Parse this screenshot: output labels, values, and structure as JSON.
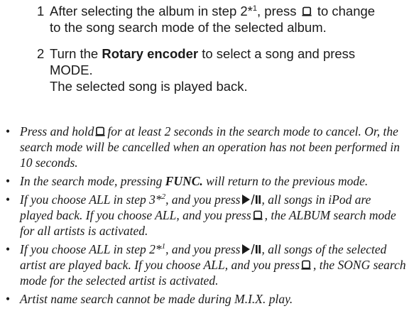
{
  "steps": [
    {
      "num": "1",
      "line1_a": "After selecting the album in step 2*",
      "line1_sup": "1",
      "line1_b": ", press",
      "line1_icon": "list-search-icon",
      "line1_c": "to change",
      "line2": "to the song search mode of the selected album."
    },
    {
      "num": "2",
      "line1_a": "Turn the",
      "line1_bold": "Rotary encoder",
      "line1_b": "to select a song and press",
      "line2": "MODE.",
      "line3": "The selected song is played back."
    }
  ],
  "notes": [
    {
      "a": "Press and hold",
      "icon": "list-search-icon",
      "b": "for at least 2 seconds in the search mode to cancel. Or, the search mode will be cancelled when an operation has not been performed in 10 seconds."
    },
    {
      "a": "In the search mode, pressing",
      "bold": "FUNC.",
      "b": "will return to the previous mode."
    },
    {
      "a": "If you choose ALL in step 3*",
      "sup": "2",
      "b": ", and you press",
      "icon1": "play-pause-icon",
      "c": ", all songs in iPod are played back. If you choose ALL, and you press",
      "icon2": "list-search-icon",
      "d": ", the ALBUM search mode for all artists is activated."
    },
    {
      "a": "If you choose ALL in step 2*",
      "sup": "1",
      "b": ", and you press",
      "icon1": "play-pause-icon",
      "c": ", all songs of the selected artist are played back. If you choose ALL, and you press",
      "icon2": "list-search-icon",
      "d": ", the SONG search mode for the selected artist is activated."
    },
    {
      "a": "Artist name search cannot be made during M.I.X. play."
    }
  ]
}
